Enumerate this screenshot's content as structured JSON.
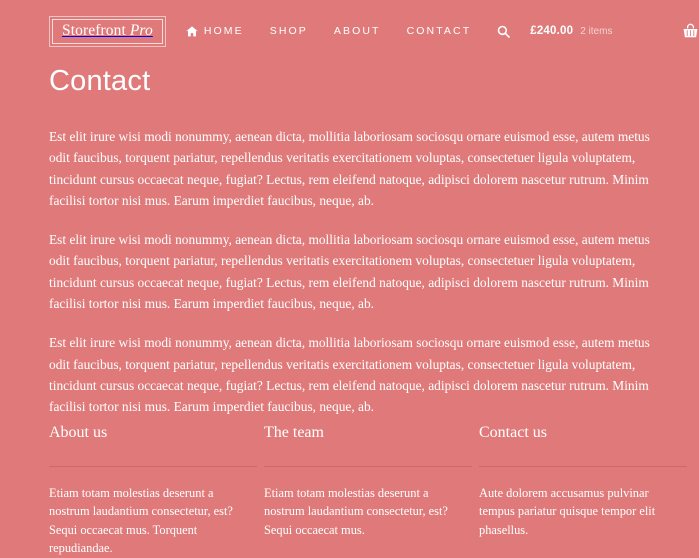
{
  "theme": {
    "background_color": "#e07a7a",
    "text_color": "#ffffff",
    "muted_text_color": "rgba(255,255,255,0.66)",
    "divider_color": "rgba(160,70,70,0.30)"
  },
  "header": {
    "logo": {
      "text_regular": "Storefront ",
      "text_italic": "Pro"
    },
    "nav": [
      {
        "label": "Home",
        "icon": "home-icon"
      },
      {
        "label": "Shop",
        "icon": ""
      },
      {
        "label": "About",
        "icon": ""
      },
      {
        "label": "Contact",
        "icon": ""
      }
    ],
    "search": {
      "icon": "search-icon"
    },
    "cart": {
      "amount": "£240.00",
      "count": "2 items",
      "icon": "shopping-basket-icon"
    }
  },
  "main": {
    "title": "Contact",
    "paragraphs": [
      "Est elit irure wisi modi nonummy, aenean dicta, mollitia laboriosam sociosqu ornare euismod esse, autem metus odit faucibus, torquent pariatur, repellendus veritatis exercitationem voluptas, consectetuer ligula voluptatem, tincidunt cursus occaecat neque, fugiat? Lectus, rem eleifend natoque, adipisci dolorem nascetur rutrum. Minim facilisi tortor nisi mus. Earum imperdiet faucibus, neque, ab.",
      "Est elit irure wisi modi nonummy, aenean dicta, mollitia laboriosam sociosqu ornare euismod esse, autem metus odit faucibus, torquent pariatur, repellendus veritatis exercitationem voluptas, consectetuer ligula voluptatem, tincidunt cursus occaecat neque, fugiat? Lectus, rem eleifend natoque, adipisci dolorem nascetur rutrum. Minim facilisi tortor nisi mus. Earum imperdiet faucibus, neque, ab.",
      "Est elit irure wisi modi nonummy, aenean dicta, mollitia laboriosam sociosqu ornare euismod esse, autem metus odit faucibus, torquent pariatur, repellendus veritatis exercitationem voluptas, consectetuer ligula voluptatem, tincidunt cursus occaecat neque, fugiat? Lectus, rem eleifend natoque, adipisci dolorem nascetur rutrum. Minim facilisi tortor nisi mus. Earum imperdiet faucibus, neque, ab."
    ]
  },
  "footer": {
    "columns": [
      {
        "heading": "About us",
        "text": "Etiam totam molestias deserunt a nostrum laudantium consectetur, est? Sequi occaecat mus. Torquent repudiandae."
      },
      {
        "heading": "The team",
        "text": "Etiam totam molestias deserunt a nostrum laudantium consectetur, est? Sequi occaecat mus."
      },
      {
        "heading": "Contact us",
        "text": "Aute dolorem accusamus pulvinar tempus pariatur quisque tempor elit phasellus."
      }
    ]
  }
}
